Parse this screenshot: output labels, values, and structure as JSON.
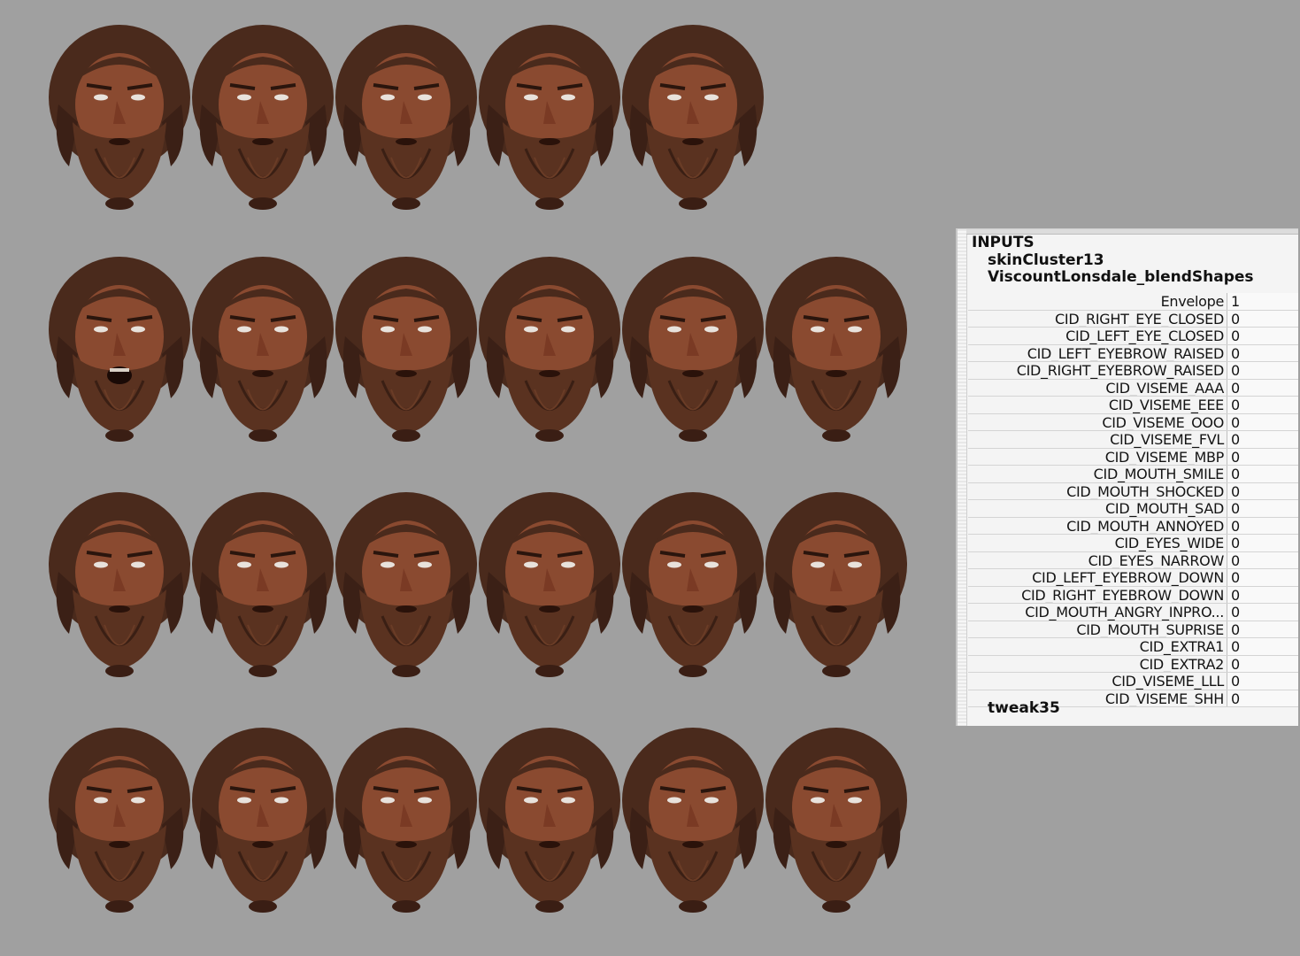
{
  "viewport": {
    "rows": [
      {
        "count": 5
      },
      {
        "count": 6
      },
      {
        "count": 6
      },
      {
        "count": 6
      }
    ]
  },
  "channel_box": {
    "inputs_label": "INPUTS",
    "skin_cluster": "skinCluster13",
    "blend_shapes_node": "ViscountLonsdale_blendShapes",
    "attributes": [
      {
        "name": "Envelope",
        "value": "1"
      },
      {
        "name": "CID_RIGHT_EYE_CLOSED",
        "value": "0"
      },
      {
        "name": "CID_LEFT_EYE_CLOSED",
        "value": "0"
      },
      {
        "name": "CID_LEFT_EYEBROW_RAISED",
        "value": "0"
      },
      {
        "name": "CID_RIGHT_EYEBROW_RAISED",
        "value": "0"
      },
      {
        "name": "CID_VISEME_AAA",
        "value": "0"
      },
      {
        "name": "CID_VISEME_EEE",
        "value": "0"
      },
      {
        "name": "CID_VISEME_OOO",
        "value": "0"
      },
      {
        "name": "CID_VISEME_FVL",
        "value": "0"
      },
      {
        "name": "CID_VISEME_MBP",
        "value": "0"
      },
      {
        "name": "CID_MOUTH_SMILE",
        "value": "0"
      },
      {
        "name": "CID_MOUTH_SHOCKED",
        "value": "0"
      },
      {
        "name": "CID_MOUTH_SAD",
        "value": "0"
      },
      {
        "name": "CID_MOUTH_ANNOYED",
        "value": "0"
      },
      {
        "name": "CID_EYES_WIDE",
        "value": "0"
      },
      {
        "name": "CID_EYES_NARROW",
        "value": "0"
      },
      {
        "name": "CID_LEFT_EYEBROW_DOWN",
        "value": "0"
      },
      {
        "name": "CID_RIGHT_EYEBROW_DOWN",
        "value": "0"
      },
      {
        "name": "CID_MOUTH_ANGRY_INPRO...",
        "value": "0"
      },
      {
        "name": "CID_MOUTH_SUPRISE",
        "value": "0"
      },
      {
        "name": "CID_EXTRA1",
        "value": "0"
      },
      {
        "name": "CID_EXTRA2",
        "value": "0"
      },
      {
        "name": "CID_VISEME_LLL",
        "value": "0"
      },
      {
        "name": "CID_VISEME_SHH",
        "value": "0"
      }
    ],
    "tweak_node": "tweak35"
  },
  "colors": {
    "viewport_bg": "#a0a0a0",
    "hair": "#4a2a1c",
    "beard": "#5a3220",
    "skin": "#8a4a30",
    "panel_bg": "#f4f4f4"
  }
}
